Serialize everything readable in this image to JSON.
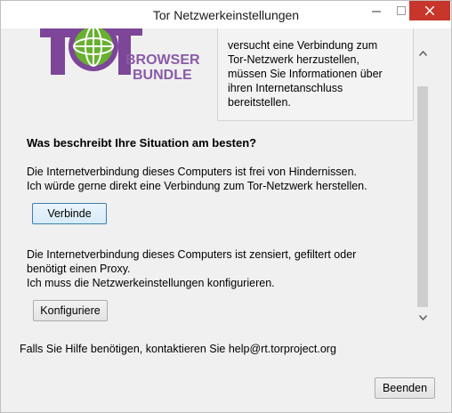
{
  "window": {
    "title": "Tor Netzwerkeinstellungen",
    "controls": {
      "minimize_icon": "minimize-icon",
      "maximize_icon": "maximize-icon",
      "close_icon": "close-icon"
    }
  },
  "logo": {
    "line1": "BROWSER",
    "line2": "BUNDLE",
    "colors": {
      "purple": "#7d4698",
      "green": "#68b030"
    }
  },
  "intro": {
    "text": "versucht eine Verbindung zum\nTor-Netzwerk herzustellen,\nmüssen Sie Informationen über\nihren Internetanschluss\nbereitstellen."
  },
  "question": "Was beschreibt Ihre Situation am besten?",
  "option_free": {
    "line1": "Die Internetverbindung dieses Computers ist frei von Hindernissen.",
    "line2": "Ich würde gerne direkt eine Verbindung zum Tor-Netzwerk herstellen.",
    "button": "Verbinde"
  },
  "option_censored": {
    "line1": "Die Internetverbindung dieses Computers ist zensiert, gefiltert oder",
    "line2": "benötigt einen Proxy.",
    "line3": "Ich muss die Netzwerkeinstellungen konfigurieren.",
    "button": "Konfiguriere"
  },
  "help_text": "Falls Sie Hilfe benötigen, kontaktieren Sie help@rt.torproject.org",
  "quit_button": "Beenden"
}
